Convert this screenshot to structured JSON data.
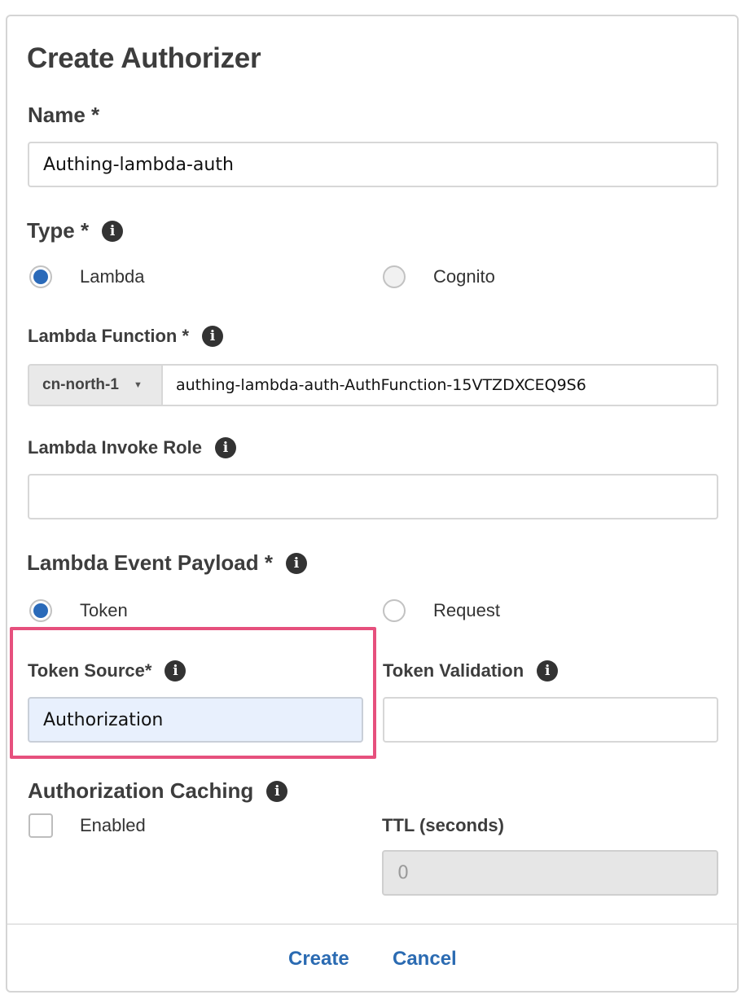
{
  "dialog": {
    "title": "Create Authorizer"
  },
  "name": {
    "label": "Name *",
    "value": "Authing-lambda-auth"
  },
  "type": {
    "label": "Type *",
    "options": [
      {
        "label": "Lambda",
        "selected": true
      },
      {
        "label": "Cognito",
        "selected": false
      }
    ]
  },
  "lambda_function": {
    "label": "Lambda Function *",
    "region": "cn-north-1",
    "value": "authing-lambda-auth-AuthFunction-15VTZDXCEQ9S6"
  },
  "lambda_invoke_role": {
    "label": "Lambda Invoke Role",
    "value": ""
  },
  "event_payload": {
    "label": "Lambda Event Payload *",
    "options": [
      {
        "label": "Token",
        "selected": true
      },
      {
        "label": "Request",
        "selected": false
      }
    ]
  },
  "token_source": {
    "label": "Token Source*",
    "value": "Authorization"
  },
  "token_validation": {
    "label": "Token Validation",
    "value": ""
  },
  "caching": {
    "label": "Authorization Caching",
    "enabled_label": "Enabled",
    "enabled": false,
    "ttl_label": "TTL (seconds)",
    "ttl_value": "0"
  },
  "actions": {
    "create": "Create",
    "cancel": "Cancel"
  },
  "colors": {
    "accent": "#2a6ab9",
    "link": "#2b6bb2",
    "highlight_border": "#e6507d",
    "highlight_fill": "#e8f0fd"
  }
}
